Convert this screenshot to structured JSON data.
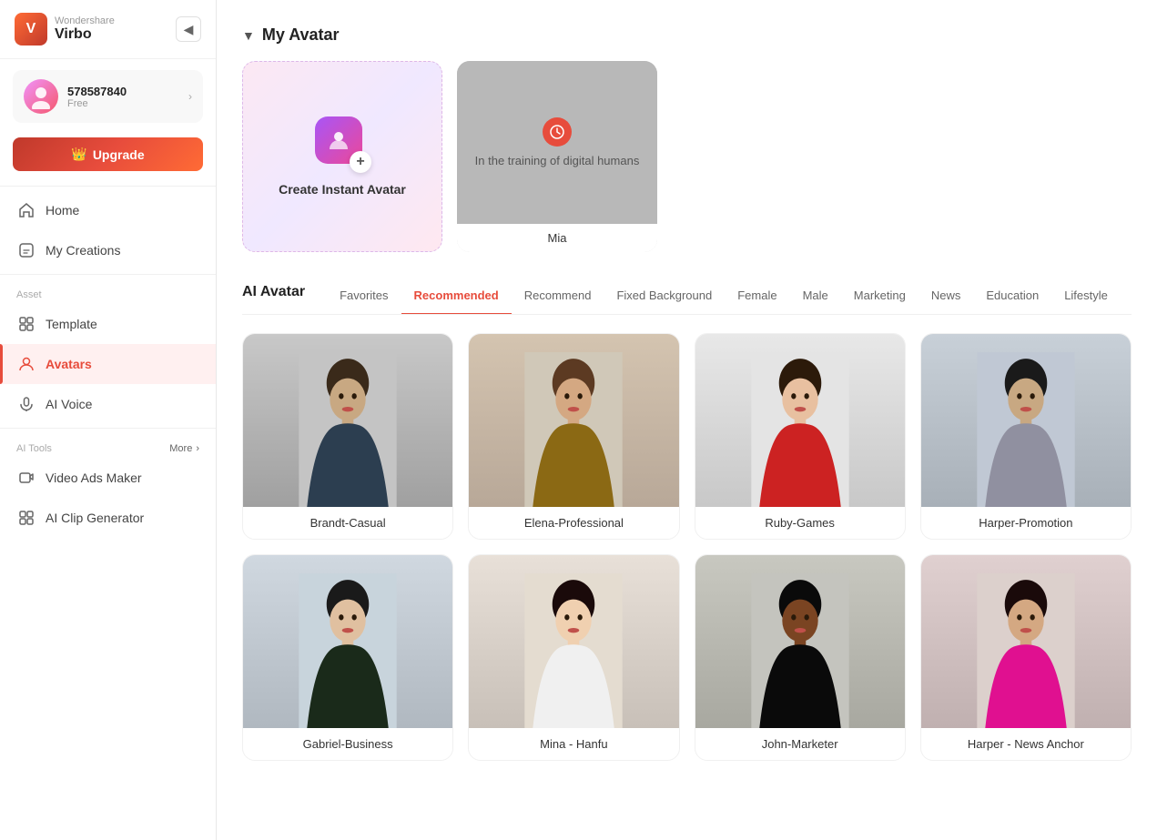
{
  "app": {
    "company": "Wondershare",
    "product": "Virbo"
  },
  "user": {
    "id": "578587840",
    "plan": "Free",
    "avatar_emoji": "👤"
  },
  "sidebar": {
    "collapse_icon": "◀",
    "upgrade_label": "Upgrade",
    "upgrade_icon": "👑",
    "nav_items": [
      {
        "id": "home",
        "label": "Home",
        "icon": "🏠",
        "active": false
      },
      {
        "id": "my-creations",
        "label": "My Creations",
        "icon": "🎭",
        "active": false
      }
    ],
    "asset_section_label": "Asset",
    "asset_items": [
      {
        "id": "template",
        "label": "Template",
        "icon": "⊞",
        "active": false
      },
      {
        "id": "avatars",
        "label": "Avatars",
        "icon": "👤",
        "active": true
      },
      {
        "id": "ai-voice",
        "label": "AI Voice",
        "icon": "🎙",
        "active": false
      }
    ],
    "tools_section_label": "AI Tools",
    "tools_more_label": "More",
    "tools_more_icon": "›",
    "tool_items": [
      {
        "id": "video-ads",
        "label": "Video Ads Maker",
        "icon": "▶"
      },
      {
        "id": "ai-clip",
        "label": "AI Clip Generator",
        "icon": "⊞"
      }
    ]
  },
  "my_avatar": {
    "section_title": "My Avatar",
    "section_arrow": "▼",
    "create_card": {
      "label": "Create Instant Avatar",
      "icon_color": "#a855f7"
    },
    "training_card": {
      "text": "In the training of digital humans",
      "name": "Mia",
      "clock_icon": "🕐"
    }
  },
  "ai_avatar": {
    "section_title": "AI Avatar",
    "tabs": [
      {
        "id": "favorites",
        "label": "Favorites",
        "active": false
      },
      {
        "id": "recommended",
        "label": "Recommended",
        "active": true
      },
      {
        "id": "recommend",
        "label": "Recommend",
        "active": false
      },
      {
        "id": "fixed-background",
        "label": "Fixed Background",
        "active": false
      },
      {
        "id": "female",
        "label": "Female",
        "active": false
      },
      {
        "id": "male",
        "label": "Male",
        "active": false
      },
      {
        "id": "marketing",
        "label": "Marketing",
        "active": false
      },
      {
        "id": "news",
        "label": "News",
        "active": false
      },
      {
        "id": "education",
        "label": "Education",
        "active": false
      },
      {
        "id": "lifestyle",
        "label": "Lifestyle",
        "active": false
      }
    ],
    "avatars": [
      {
        "id": "brandt",
        "label": "Brandt-Casual",
        "bg": "avatar-bg-1",
        "gender": "male",
        "skin": "#c8a882"
      },
      {
        "id": "elena",
        "label": "Elena-Professional",
        "bg": "avatar-bg-2",
        "gender": "female",
        "skin": "#d4a882"
      },
      {
        "id": "ruby",
        "label": "Ruby-Games",
        "bg": "avatar-bg-3",
        "gender": "female",
        "skin": "#e8c0a0"
      },
      {
        "id": "harper-promo",
        "label": "Harper-Promotion",
        "bg": "avatar-bg-4",
        "gender": "female",
        "skin": "#c8a882"
      },
      {
        "id": "gabriel",
        "label": "Gabriel-Business",
        "bg": "avatar-bg-5",
        "gender": "male",
        "skin": "#e0c0a0"
      },
      {
        "id": "mina-hanfu",
        "label": "Mina - Hanfu",
        "bg": "avatar-bg-6",
        "gender": "female",
        "skin": "#f0d0b0"
      },
      {
        "id": "john",
        "label": "John-Marketer",
        "bg": "avatar-bg-7",
        "gender": "male",
        "skin": "#885533"
      },
      {
        "id": "harper-news",
        "label": "Harper - News Anchor",
        "bg": "avatar-bg-8",
        "gender": "female",
        "skin": "#d4a882"
      }
    ]
  }
}
